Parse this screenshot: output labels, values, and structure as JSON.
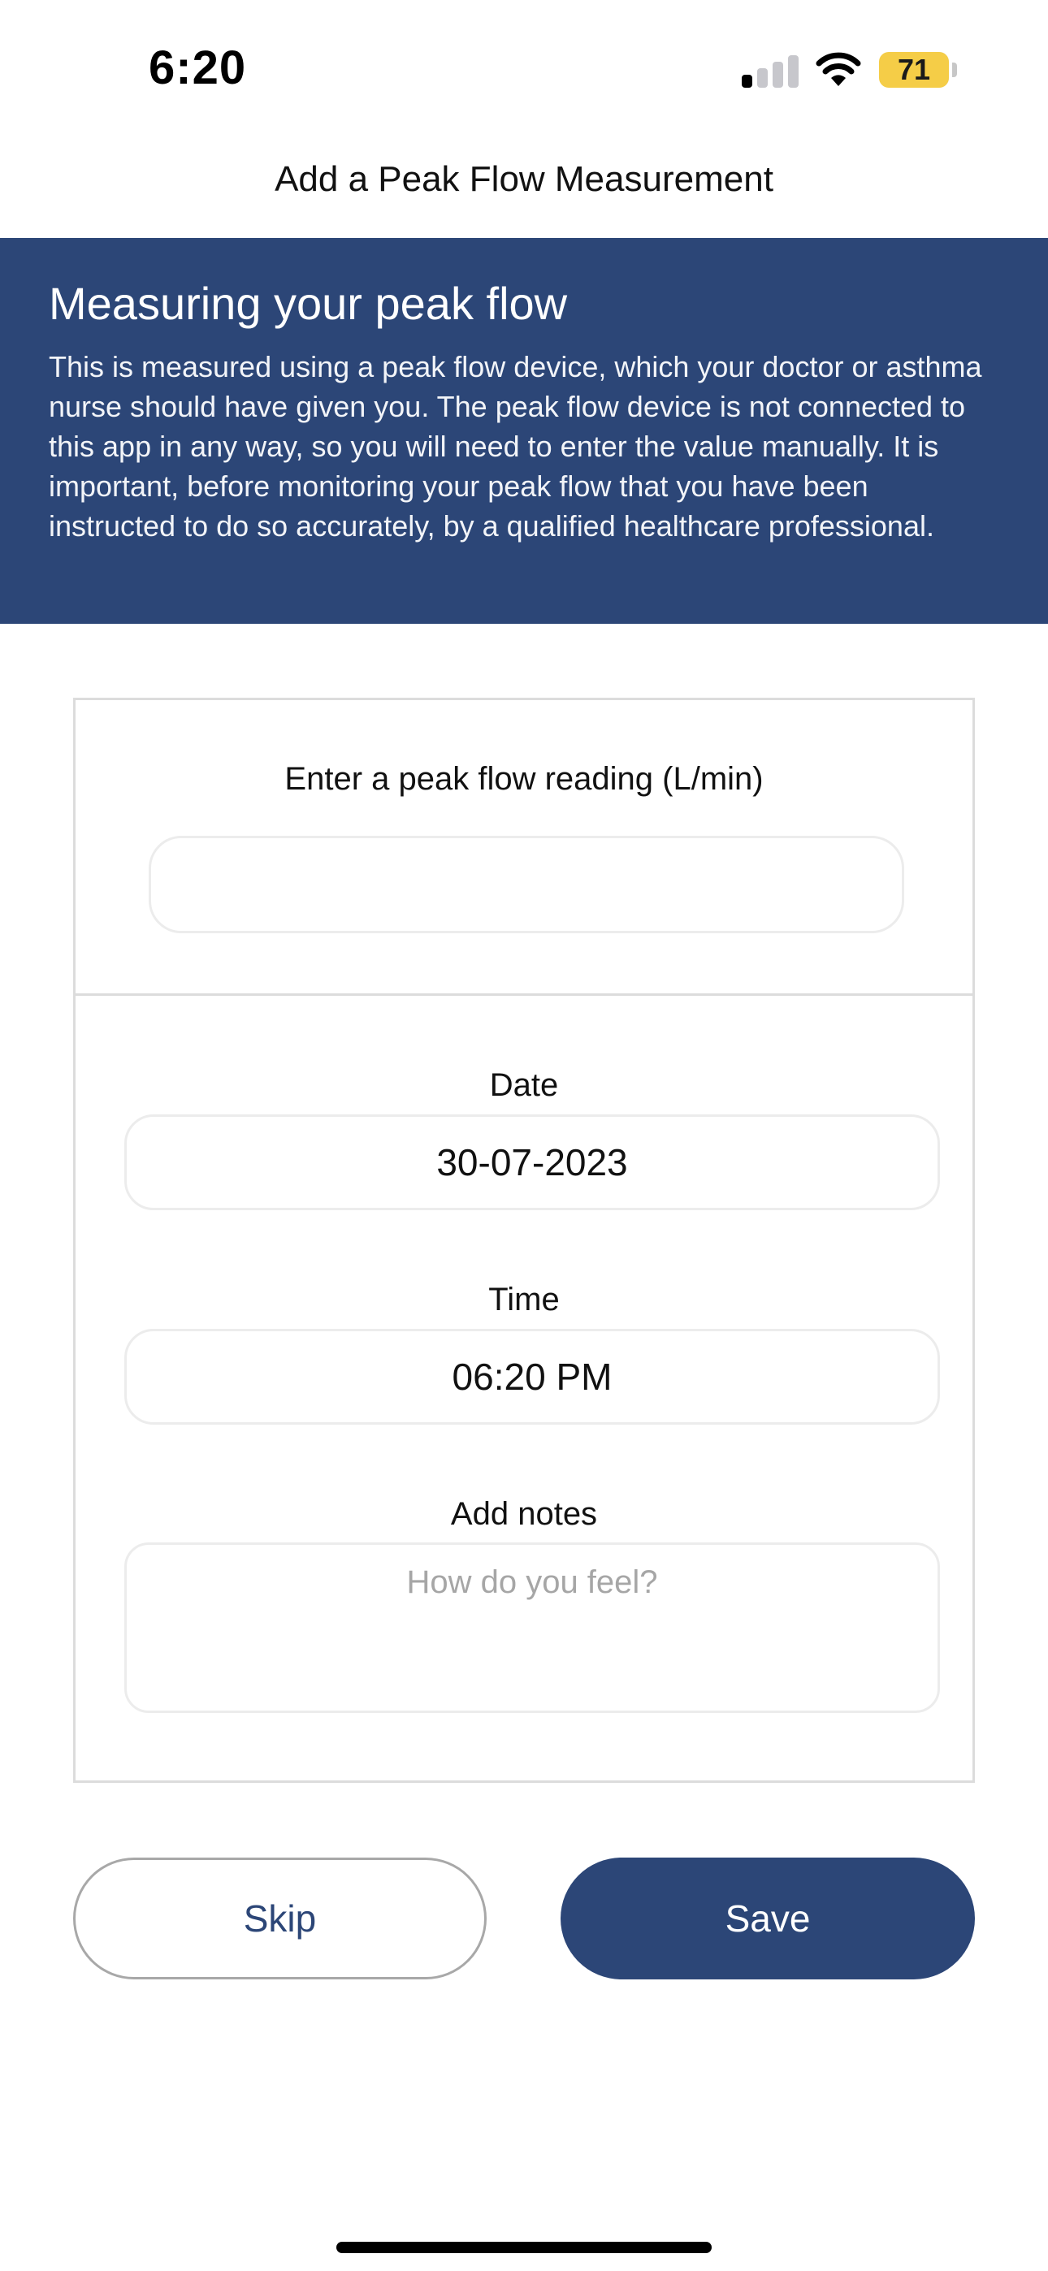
{
  "status_bar": {
    "time": "6:20",
    "battery_level": "71",
    "signal_bars_active": 1,
    "signal_bars_total": 4,
    "battery_color": "#f5cd47"
  },
  "header": {
    "title": "Add a Peak Flow Measurement"
  },
  "banner": {
    "title": "Measuring your peak flow",
    "body": "This is measured using a peak flow device, which your doctor or asthma nurse should have given you. The peak flow device is not connected to this app in any way, so you will need to enter the value manually. It is important, before monitoring your peak flow that you have been instructed to do so accurately, by a qualified healthcare professional.",
    "background_color": "#2c4677"
  },
  "form": {
    "reading_label": "Enter a peak flow reading (L/min)",
    "reading_value": "",
    "date_label": "Date",
    "date_value": "30-07-2023",
    "time_label": "Time",
    "time_value": "06:20 PM",
    "notes_label": "Add notes",
    "notes_placeholder": "How do you feel?"
  },
  "actions": {
    "skip_label": "Skip",
    "save_label": "Save",
    "accent_color": "#2c4677"
  },
  "icons": {
    "signal": "cellular-signal-icon",
    "wifi": "wifi-icon",
    "battery": "battery-icon"
  }
}
